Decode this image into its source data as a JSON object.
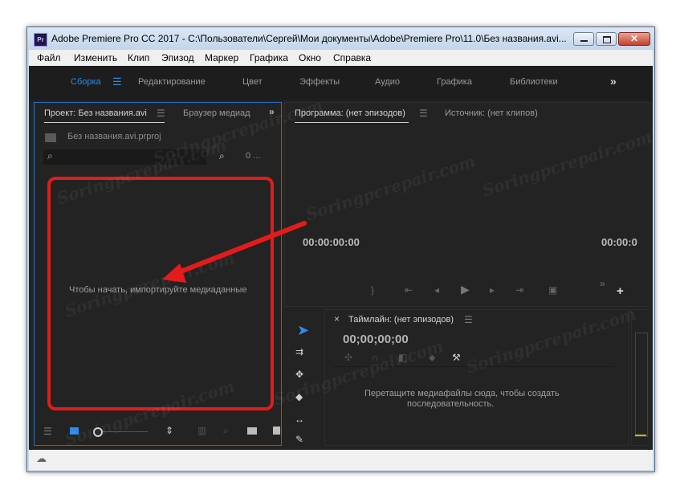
{
  "window": {
    "title": "Adobe Premiere Pro CC 2017 - C:\\Пользователи\\Сергей\\Мои документы\\Adobe\\Premiere Pro\\11.0\\Без названия.avi...",
    "app_icon": "Pr"
  },
  "menu": [
    "Файл",
    "Изменить",
    "Клип",
    "Эпизод",
    "Маркер",
    "Графика",
    "Окно",
    "Справка"
  ],
  "workspaces": {
    "items": [
      "Сборка",
      "Редактирование",
      "Цвет",
      "Эффекты",
      "Аудио",
      "Графика",
      "Библиотеки"
    ],
    "active": "Сборка",
    "overflow": "»"
  },
  "project": {
    "tab_active": "Проект: Без названия.avi",
    "tab_other": "Браузер медиад",
    "file": "Без названия.avi.prproj",
    "items_count": "0 ...",
    "empty_text": "Чтобы начать, импортируйте медиаданные"
  },
  "program": {
    "tab_active": "Программа: (нет эпизодов)",
    "tab_other": "Источник: (нет клипов)",
    "timecode_left": "00:00:00:00",
    "timecode_right": "00:00:0"
  },
  "timeline": {
    "tab": "Таймлайн: (нет эпизодов)",
    "timecode": "00;00;00;00",
    "drop_text_line1": "Перетащите медиафайлы сюда, чтобы создать",
    "drop_text_line2": "последовательность."
  },
  "annotation": {
    "color": "#e51b1b"
  },
  "watermark": "Soringpcrepair.com",
  "colors": {
    "accent": "#2d8ceb",
    "panel_bg": "#232323",
    "text_dim": "#9a9a9a"
  }
}
